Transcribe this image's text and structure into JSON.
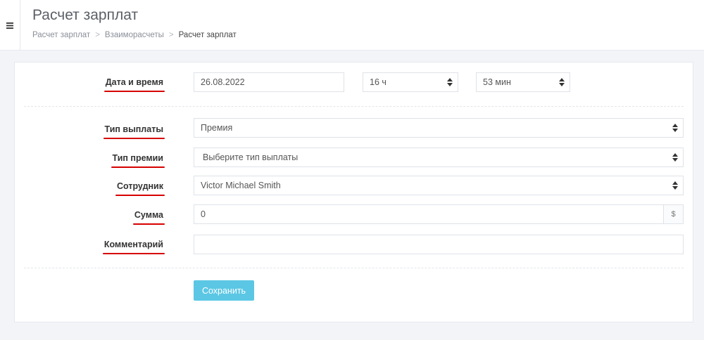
{
  "header": {
    "title": "Расчет зарплат",
    "breadcrumb": [
      {
        "label": "Расчет зарплат"
      },
      {
        "label": "Взаиморасчеты"
      },
      {
        "label": "Расчет зарплат"
      }
    ],
    "separator": ">"
  },
  "form": {
    "datetime": {
      "label": "Дата и время",
      "date": "26.08.2022",
      "hour": "16 ч",
      "minute": "53 мин"
    },
    "payment_type": {
      "label": "Тип выплаты",
      "value": "Премия"
    },
    "bonus_type": {
      "label": "Тип премии",
      "value": "Выберите тип выплаты"
    },
    "employee": {
      "label": "Сотрудник",
      "value": "Victor Michael Smith"
    },
    "amount": {
      "label": "Сумма",
      "value": "0",
      "currency": "$"
    },
    "comment": {
      "label": "Комментарий",
      "value": ""
    },
    "save_label": "Сохранить"
  },
  "colors": {
    "accent": "#5bc7e4",
    "underline": "#d60000",
    "background": "#f3f4f8"
  },
  "icons": {
    "menu": "hamburger-icon",
    "select": "sort-caret-icon"
  }
}
